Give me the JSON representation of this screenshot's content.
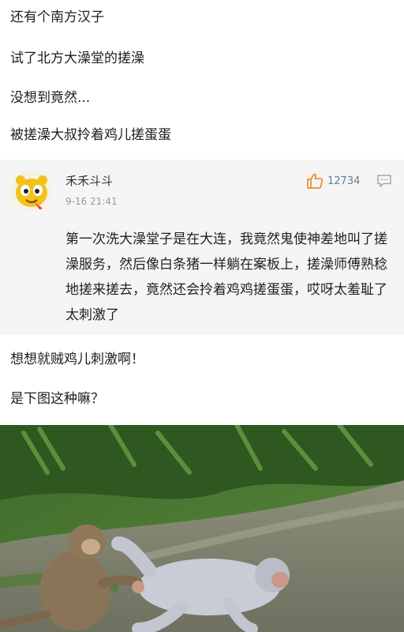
{
  "intro": {
    "lines": [
      "还有个南方汉子",
      "试了北方大澡堂的搓澡",
      "没想到竟然...",
      "被搓澡大叔拎着鸡儿搓蛋蛋"
    ]
  },
  "comment": {
    "username": "禾禾斗斗",
    "timestamp": "9-16 21:41",
    "like_count": "12734",
    "like_icon": "thumbs-up-icon",
    "reply_icon": "comment-icon",
    "avatar_icon": "cartoon-avatar",
    "body": "第一次洗大澡堂子是在大连，我竟然鬼使神差地叫了搓澡服务，然后像白条猪一样躺在案板上，搓澡师傅熟稔地搓来搓去，竟然还会拎着鸡鸡搓蛋蛋，哎呀太羞耻了太刺激了"
  },
  "outro": {
    "lines": [
      "想想就贼鸡儿刺激啊！",
      "是下图这种嘛？"
    ]
  },
  "colors": {
    "like_orange": "#f08a24",
    "meta_gray": "#9a9a9a",
    "card_bg": "#f5f5f5"
  }
}
